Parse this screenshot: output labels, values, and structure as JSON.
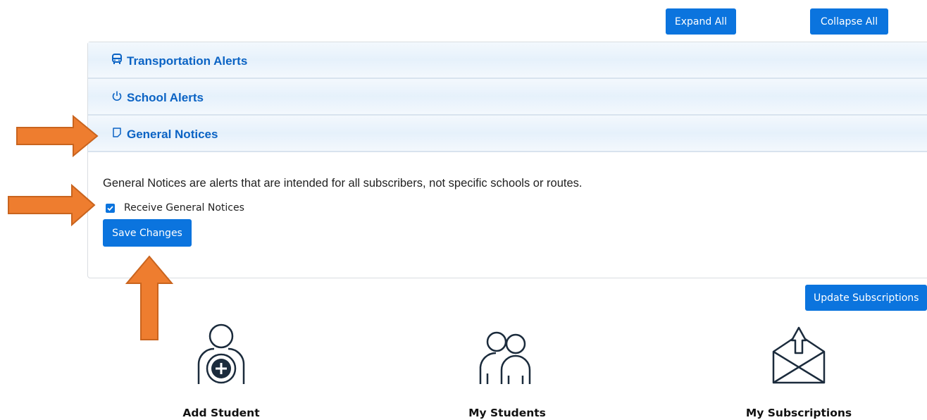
{
  "toolbar": {
    "expand_all": "Expand All",
    "collapse_all": "Collapse All"
  },
  "accordion": {
    "sections": [
      {
        "label": "Transportation Alerts",
        "icon": "bus-icon",
        "expanded": false
      },
      {
        "label": "School Alerts",
        "icon": "power-icon",
        "expanded": false
      },
      {
        "label": "General Notices",
        "icon": "sticky-note-icon",
        "expanded": true
      }
    ],
    "general_notices": {
      "description": "General Notices are alerts that are intended for all subscribers, not specific schools or routes.",
      "checkbox_label": "Receive General Notices",
      "checkbox_checked": true,
      "save_label": "Save Changes"
    }
  },
  "update_subscriptions": "Update Subscriptions",
  "tiles": [
    {
      "label": "Add Student",
      "icon": "add-person-icon"
    },
    {
      "label": "My Students",
      "icon": "two-people-icon"
    },
    {
      "label": "My Subscriptions",
      "icon": "envelope-upload-icon"
    }
  ],
  "colors": {
    "primary": "#0b74de",
    "header_text": "#0b63c4",
    "arrow": "#ee7d2f",
    "icon_stroke": "#1b2b3c"
  }
}
